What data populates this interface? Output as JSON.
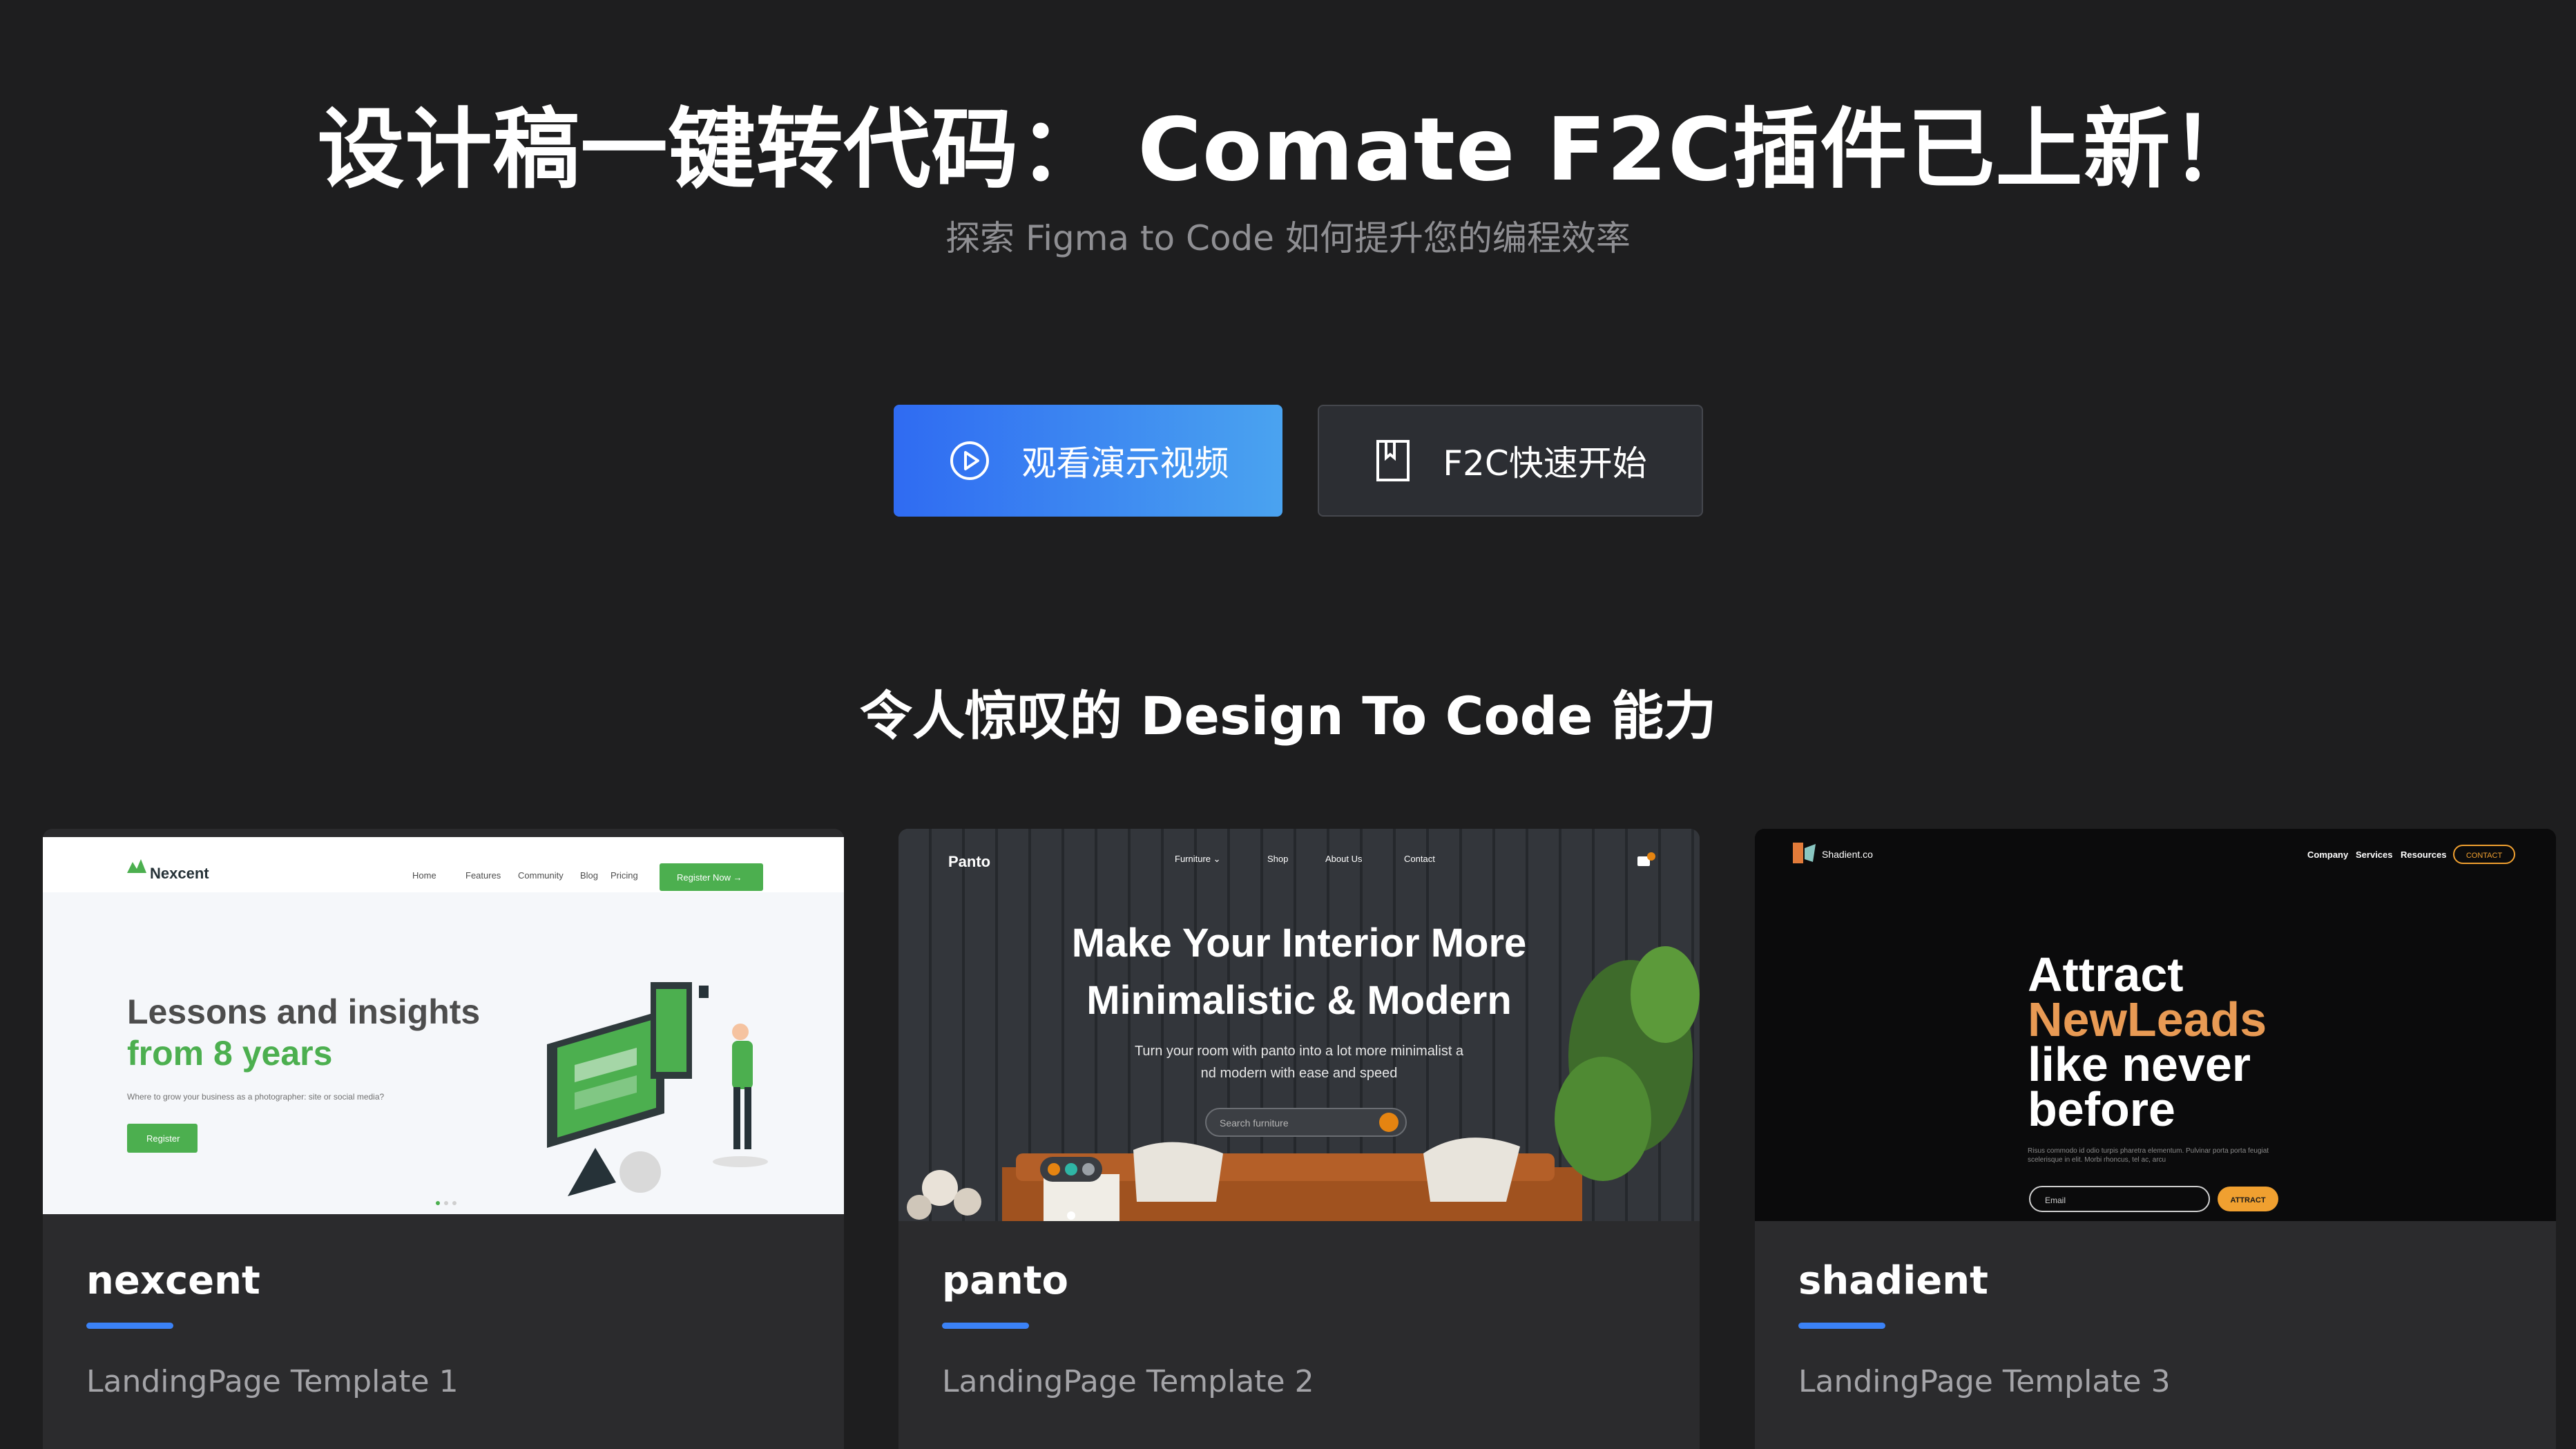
{
  "hero": {
    "title": "设计稿一键转代码： Comate F2C插件已上新！",
    "subtitle": "探索 Figma to Code 如何提升您的编程效率"
  },
  "buttons": {
    "watch_demo": "观看演示视频",
    "quick_start": "F2C快速开始"
  },
  "section": {
    "title": "令人惊叹的 Design To Code 能力"
  },
  "cards": [
    {
      "name": "nexcent",
      "desc": "LandingPage Template 1",
      "preview": {
        "logo": "Nexcent",
        "nav": [
          "Home",
          "Features",
          "Community",
          "Blog",
          "Pricing"
        ],
        "cta": "Register Now →",
        "headline_1": "Lessons and insights",
        "headline_2": "from 8 years",
        "sub": "Where to grow your business as a photographer: site or social media?",
        "button": "Register"
      }
    },
    {
      "name": "panto",
      "desc": "LandingPage Template 2",
      "preview": {
        "logo": "Panto",
        "nav": [
          "Furniture ⌄",
          "Shop",
          "About Us",
          "Contact"
        ],
        "headline_1": "Make Your Interior More",
        "headline_2": "Minimalistic & Modern",
        "sub_1": "Turn your room with panto into a lot more minimalist a",
        "sub_2": "nd modern with ease and speed",
        "search_placeholder": "Search furniture"
      }
    },
    {
      "name": "shadient",
      "desc": "LandingPage Template 3",
      "preview": {
        "logo": "Shadient.co",
        "nav": [
          "Company",
          "Services",
          "Resources"
        ],
        "contact": "CONTACT",
        "line_1": "Attract",
        "line_2": "NewLeads",
        "line_3": "like never",
        "line_4": "before",
        "sub": "Risus commodo id odio turpis pharetra elementum. Pulvinar porta porta feugiat scelerisque in elit. Morbi rhoncus, tel ac, arcu",
        "email_placeholder": "Email",
        "button": "ATTRACT"
      }
    }
  ],
  "colors": {
    "background": "#1e1e1f",
    "accent_blue": "#3b82f6",
    "nexcent_green": "#4caf4f",
    "shadient_orange": "#f0a030"
  }
}
